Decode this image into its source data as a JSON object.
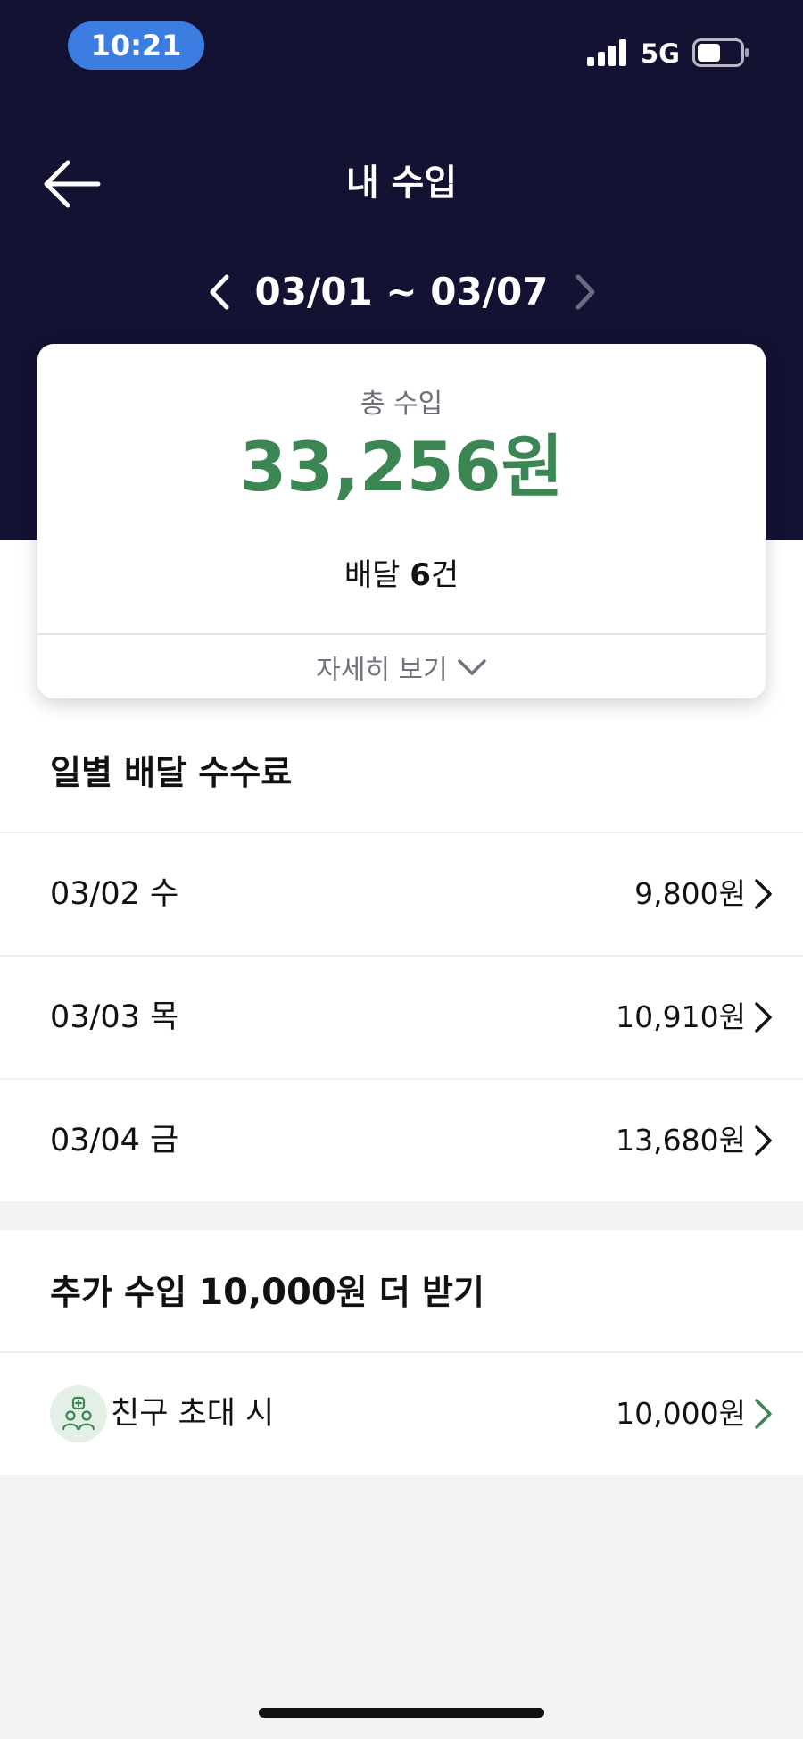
{
  "status_bar": {
    "time": "10:21",
    "network": "5G",
    "icons": [
      "signal-icon",
      "battery-icon"
    ]
  },
  "header": {
    "title": "내 수입",
    "back_icon": "arrow-left-icon",
    "week_range": "03/01 ~ 03/07",
    "prev_icon": "chevron-left-icon",
    "next_icon": "chevron-right-icon"
  },
  "summary": {
    "total_label": "총 수입",
    "total_amount": "33,256원",
    "delivery_prefix": "배달 ",
    "delivery_count": "6",
    "delivery_suffix": "건",
    "details_label": "자세히 보기"
  },
  "daily_fees": {
    "heading": "일별 배달 수수료",
    "rows": [
      {
        "date": "03/02 수",
        "amount": "9,800원"
      },
      {
        "date": "03/03 목",
        "amount": "10,910원"
      },
      {
        "date": "03/04 금",
        "amount": "13,680원"
      }
    ]
  },
  "bonus": {
    "heading_prefix": "추가 수입 ",
    "heading_amount": "10,000",
    "heading_suffix": "원 더 받기",
    "invite_label": "친구 초대 시",
    "invite_amount": "10,000원",
    "invite_icon": "invite-friends-icon"
  },
  "colors": {
    "header_bg": "#141233",
    "accent_green": "#3c8653",
    "time_pill": "#3b7de0"
  }
}
